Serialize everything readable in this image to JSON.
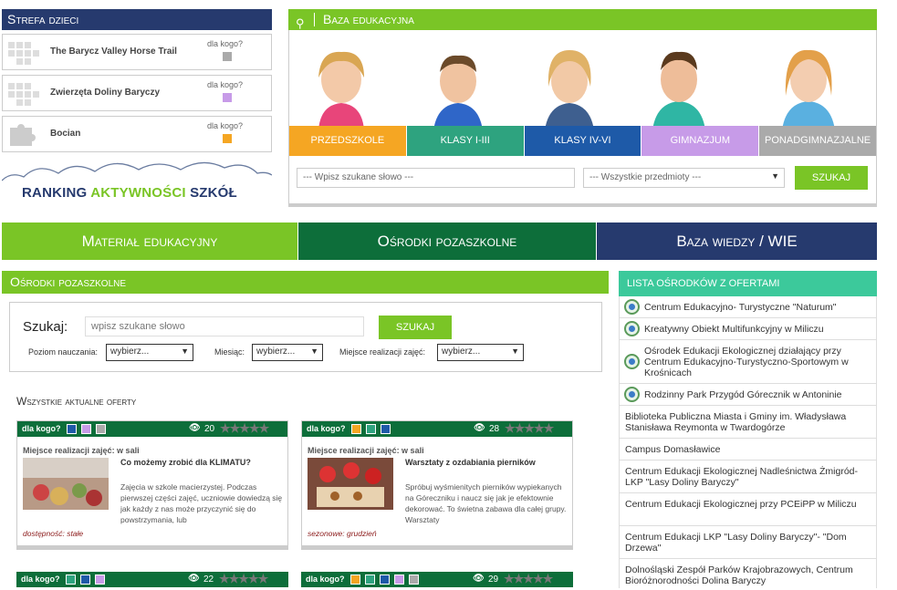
{
  "strefa": {
    "title": "Strefa dzieci",
    "who_label": "dla kogo?",
    "items": [
      {
        "title": "The Barycz Valley Horse Trail",
        "color": "#aaaaaa"
      },
      {
        "title": "Zwierzęta Doliny Baryczy",
        "color": "#c79be8"
      },
      {
        "title": "Bocian",
        "color": "#f5a623"
      }
    ]
  },
  "ranking": {
    "part1": "RANKING ",
    "part2": "AKTYWNOŚCI",
    "part3": " SZKÓŁ"
  },
  "baza": {
    "title": "Baza edukacyjna",
    "tabs": [
      {
        "label": "PRZEDSZKOLE",
        "color": "#f5a623"
      },
      {
        "label": "KLASY I-III",
        "color": "#2ea37f"
      },
      {
        "label": "KLASY IV-VI",
        "color": "#1e5aa8"
      },
      {
        "label": "GIMNAZJUM",
        "color": "#c79be8"
      },
      {
        "label": "PONADGIMNAZJALNE",
        "color": "#aaaaaa"
      }
    ],
    "search_placeholder": "--- Wpisz szukane słowo ---",
    "subject_select": "--- Wszystkie przedmioty ---",
    "search_button": "SZUKAJ"
  },
  "nav": [
    {
      "label": "Materiał edukacyjny",
      "color": "#7ac526"
    },
    {
      "label": "Ośrodki pozaszkolne",
      "color": "#0d6e3a"
    },
    {
      "label": "Baza wiedzy / WIE",
      "color": "#263a6e"
    }
  ],
  "osrodki": {
    "title": "Ośrodki pozaszkolne",
    "search_label": "Szukaj:",
    "search_placeholder": "wpisz szukane słowo",
    "search_button": "SZUKAJ",
    "filters": [
      {
        "label": "Poziom nauczania:",
        "value": "wybierz..."
      },
      {
        "label": "Miesiąc:",
        "value": "wybierz..."
      },
      {
        "label": "Miejsce realizacji zajęć:",
        "value": "wybierz..."
      }
    ],
    "all_offers_title": "Wszystkie aktualne oferty"
  },
  "offers": [
    {
      "who": "dla kogo?",
      "squares": [
        "#1e5aa8",
        "#c79be8",
        "#aaaaaa"
      ],
      "views": "20",
      "place": "Miejsce realizacji zajęć: w sali",
      "title": "Co możemy zrobić dla KLIMATU?",
      "desc": "Zajęcia w szkole macierzystej. Podczas pierwszej części zajęć, uczniowie dowiedzą się jak każdy z nas może przyczynić się do powstrzymania, lub",
      "foot": "dostępność: stałe"
    },
    {
      "who": "dla kogo?",
      "squares": [
        "#f5a623",
        "#2ea37f",
        "#1e5aa8"
      ],
      "views": "28",
      "place": "Miejsce realizacji zajęć: w sali",
      "title": "Warsztaty z ozdabiania pierników",
      "desc": "Spróbuj wyśmienitych pierników wypiekanych na Góreczniku i naucz się jak je efektownie dekorować. To świetna zabawa dla całej grupy. Warsztaty",
      "foot": "sezonowe: grudzień"
    },
    {
      "who": "dla kogo?",
      "squares": [
        "#2ea37f",
        "#1e5aa8",
        "#c79be8"
      ],
      "views": "22"
    },
    {
      "who": "dla kogo?",
      "squares": [
        "#f5a623",
        "#2ea37f",
        "#1e5aa8",
        "#c79be8",
        "#aaaaaa"
      ],
      "views": "29"
    }
  ],
  "lista": {
    "title": "LISTA OŚRODKÓW Z OFERTAMI",
    "items": [
      {
        "label": "Centrum Edukacyjno- Turystyczne \"Naturum\"",
        "logo": true
      },
      {
        "label": "Kreatywny Obiekt Multifunkcyjny w Miliczu",
        "logo": true
      },
      {
        "label": "Ośrodek Edukacji Ekologicznej działający przy Centrum Edukacyjno-Turystyczno-Sportowym w Krośnicach",
        "logo": true
      },
      {
        "label": "Rodzinny Park Przygód Górecznik w Antoninie",
        "logo": true
      },
      {
        "label": "Biblioteka Publiczna Miasta i Gminy im. Władysława Stanisława Reymonta w Twardogórze",
        "logo": false
      },
      {
        "label": "Campus Domasławice",
        "logo": false
      },
      {
        "label": "Centrum Edukacji Ekologicznej Nadleśnictwa Żmigród- LKP \"Lasy Doliny Baryczy\"",
        "logo": false
      },
      {
        "label": "Centrum Edukacji Ekologicznej przy PCEiPP w Miliczu",
        "logo": false
      },
      {
        "label": "Centrum Edukacji LKP \"Lasy Doliny Baryczy\"- \"Dom Drzewa\"",
        "logo": false
      },
      {
        "label": "Dolnośląski Zespół Parków Krajobrazowych, Centrum Bioróżnorodności Dolina Baryczy",
        "logo": false
      }
    ]
  }
}
